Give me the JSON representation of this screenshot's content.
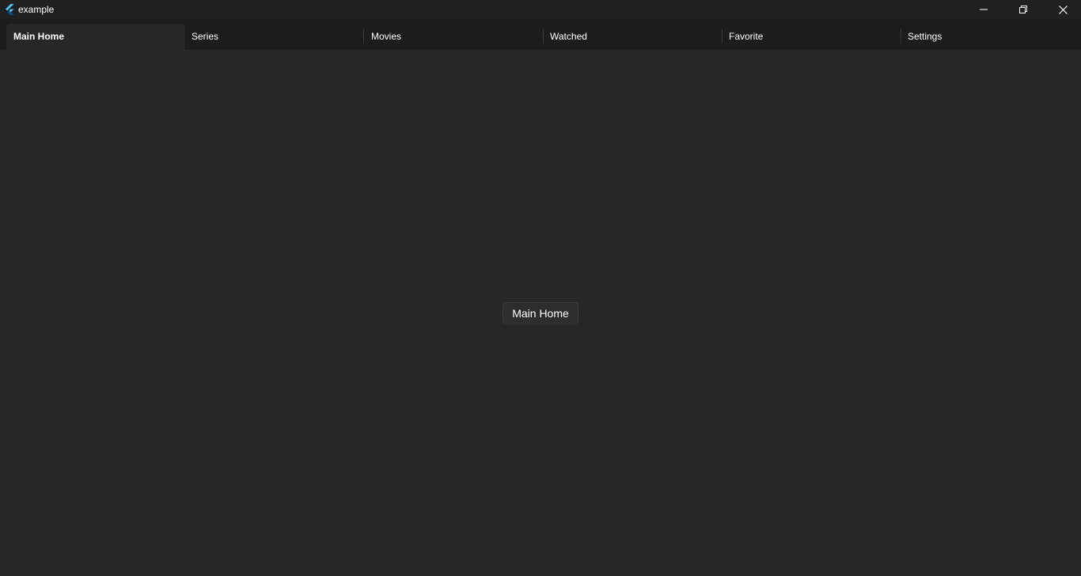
{
  "window": {
    "title": "example",
    "app_icon": "flutter-logo-icon",
    "controls": {
      "minimize_icon": "minimize-icon",
      "maximize_icon": "restore-icon",
      "close_icon": "close-icon"
    }
  },
  "tabs": [
    {
      "label": "Main Home",
      "active": true
    },
    {
      "label": "Series",
      "active": false
    },
    {
      "label": "Movies",
      "active": false
    },
    {
      "label": "Watched",
      "active": false
    },
    {
      "label": "Favorite",
      "active": false
    },
    {
      "label": "Settings",
      "active": false
    }
  ],
  "content": {
    "button_label": "Main Home"
  },
  "colors": {
    "background": "#272727",
    "titlebar": "#202020",
    "tabbar": "#1c1c1c",
    "text": "#ffffff",
    "flutter_blue": "#54c5f8"
  }
}
